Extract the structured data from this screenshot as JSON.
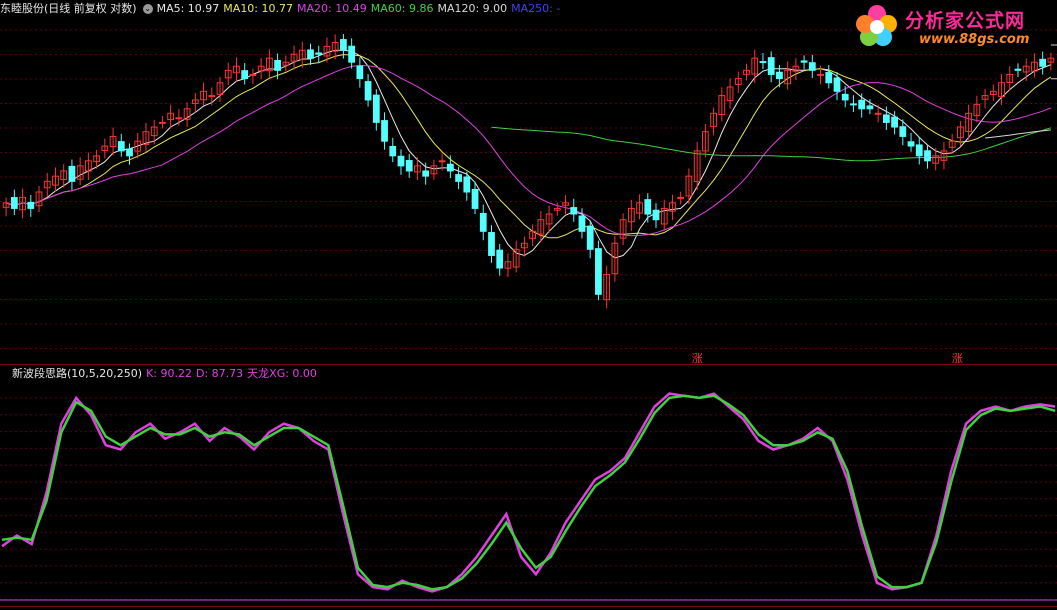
{
  "header": {
    "stock_name": "东睦股份",
    "period_label": "(日线 前复权 对数)",
    "ma": [
      {
        "label": "MA5: 10.97",
        "color": "#e8e8e8"
      },
      {
        "label": "MA10: 10.77",
        "color": "#e8e85a"
      },
      {
        "label": "MA20: 10.49",
        "color": "#e040e0"
      },
      {
        "label": "MA60: 9.86",
        "color": "#40d040"
      },
      {
        "label": "MA120: 9.00",
        "color": "#d8d8d8"
      },
      {
        "label": "MA250: -",
        "color": "#4040ff"
      }
    ]
  },
  "indicator": {
    "name": "新波段思路(10,5,20,250)",
    "k_label": "K: 90.22",
    "d_label": "D: 87.73",
    "xg_label": "天龙XG: 0.00",
    "k_color": "#e040e0",
    "d_color": "#40d040",
    "xg_color": "#e040e0"
  },
  "logo": {
    "title": "分析家公式网",
    "url": "www.88gs.com"
  },
  "icons": [
    "circle-arrow-icon",
    "flower-logo-icon"
  ],
  "colors": {
    "up": "#ff3232",
    "down": "#54ffff",
    "grid": "#5a0010"
  },
  "chart_data": [
    {
      "type": "candlestick",
      "price_range": [
        5.8,
        12.2
      ],
      "high_marker": "11.66",
      "low_marker": "6.23",
      "signal_marks": [
        "涨",
        "涨"
      ],
      "close": [
        8.1,
        8.0,
        8.2,
        8.0,
        8.3,
        8.5,
        8.6,
        8.7,
        8.5,
        8.8,
        8.9,
        9.0,
        9.2,
        9.4,
        9.1,
        9.0,
        9.3,
        9.5,
        9.6,
        9.7,
        9.9,
        9.8,
        10.0,
        10.2,
        10.4,
        10.3,
        10.6,
        10.9,
        11.0,
        10.7,
        10.8,
        11.0,
        11.2,
        10.9,
        11.1,
        11.3,
        11.4,
        11.2,
        11.3,
        11.5,
        11.6,
        11.4,
        11.1,
        10.7,
        10.2,
        9.7,
        9.3,
        9.0,
        8.8,
        8.7,
        8.8,
        8.6,
        8.8,
        8.9,
        8.7,
        8.5,
        8.3,
        8.0,
        7.6,
        7.2,
        7.0,
        7.1,
        7.3,
        7.4,
        7.6,
        7.8,
        7.9,
        8.0,
        8.1,
        7.9,
        7.6,
        7.3,
        6.6,
        6.9,
        7.4,
        7.8,
        8.0,
        8.1,
        7.9,
        7.8,
        8.0,
        8.1,
        8.2,
        8.6,
        9.1,
        9.5,
        9.9,
        10.3,
        10.5,
        10.7,
        10.9,
        11.2,
        11.1,
        10.8,
        10.7,
        10.9,
        11.0,
        11.1,
        10.9,
        10.8,
        10.6,
        10.4,
        10.2,
        10.1,
        10.0,
        10.0,
        9.9,
        9.7,
        9.6,
        9.4,
        9.2,
        9.0,
        8.9,
        9.0,
        9.1,
        9.3,
        9.6,
        9.9,
        10.1,
        10.3,
        10.4,
        10.6,
        10.8,
        10.9,
        11.0,
        11.1,
        11.0,
        11.2
      ],
      "ma_values": {
        "MA5": 10.97,
        "MA10": 10.77,
        "MA20": 10.49,
        "MA60": 9.86,
        "MA120": 9.0,
        "MA250": null
      }
    },
    {
      "type": "line",
      "ylim": [
        0,
        100
      ],
      "series": [
        {
          "name": "K",
          "values": [
            25,
            30,
            26,
            50,
            82,
            94,
            86,
            72,
            70,
            78,
            82,
            75,
            78,
            82,
            74,
            80,
            76,
            70,
            78,
            82,
            80,
            74,
            70,
            40,
            12,
            6,
            5,
            9,
            6,
            4,
            6,
            12,
            20,
            30,
            40,
            20,
            12,
            22,
            36,
            46,
            56,
            60,
            66,
            78,
            90,
            96,
            95,
            94,
            96,
            90,
            84,
            74,
            70,
            72,
            75,
            80,
            74,
            56,
            30,
            8,
            5,
            6,
            8,
            30,
            60,
            82,
            88,
            90,
            88,
            90,
            91,
            90
          ]
        },
        {
          "name": "D",
          "values": [
            28,
            29,
            28,
            46,
            78,
            92,
            88,
            76,
            72,
            76,
            80,
            77,
            77,
            80,
            76,
            78,
            77,
            72,
            76,
            80,
            80,
            76,
            72,
            44,
            15,
            7,
            6,
            8,
            7,
            5,
            6,
            10,
            17,
            26,
            36,
            24,
            15,
            20,
            32,
            43,
            53,
            58,
            64,
            75,
            87,
            94,
            95,
            94,
            95,
            91,
            86,
            77,
            72,
            72,
            74,
            78,
            75,
            60,
            34,
            11,
            6,
            6,
            8,
            27,
            55,
            79,
            86,
            89,
            88,
            89,
            90,
            88
          ]
        }
      ],
      "xg_signal": 0
    }
  ]
}
